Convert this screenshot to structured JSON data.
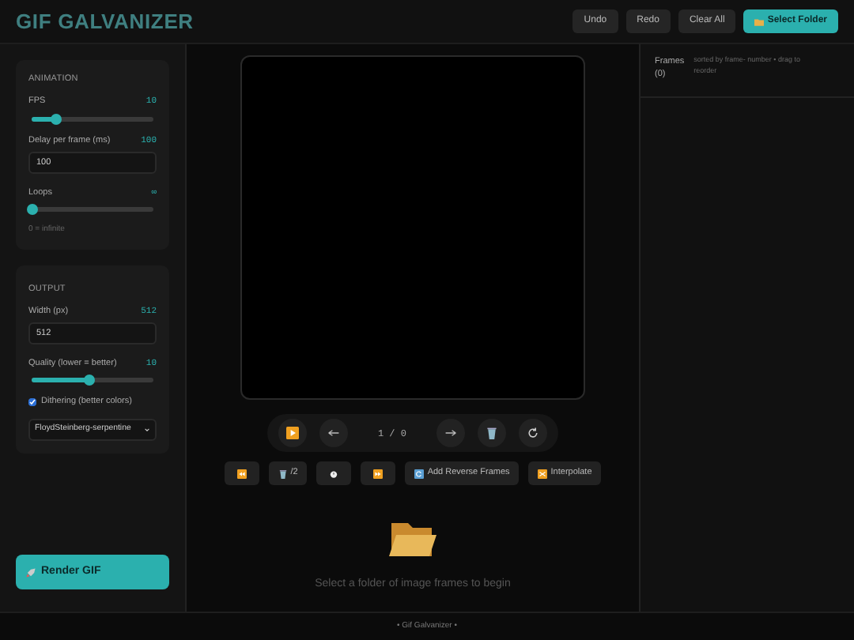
{
  "header": {
    "title": "GIF GALVANIZER",
    "buttons": [
      {
        "label": "Undo",
        "kind": "plain"
      },
      {
        "label": "Redo",
        "kind": "plain"
      },
      {
        "label": "Clear All",
        "kind": "plain"
      },
      {
        "label": "Select Folder",
        "kind": "primary"
      }
    ]
  },
  "animation": {
    "heading": "ANIMATION",
    "fps": {
      "label": "FPS",
      "reading": "10",
      "level": 0.2
    },
    "delay": {
      "label": "Delay per frame (ms)",
      "reading": "100",
      "value": "100"
    },
    "loops": {
      "label": "Loops",
      "reading": "∞",
      "level": 0
    },
    "hint": "0 = infinite"
  },
  "output": {
    "heading": "OUTPUT",
    "width": {
      "label": "Width (px)",
      "reading": "512",
      "value": "512"
    },
    "quality": {
      "label": "Quality (lower = better)",
      "reading": "10",
      "level": 0.48
    },
    "dithering": {
      "label": "Dithering (better colors)",
      "checked": true
    },
    "dither_mode": "FloydSteinberg-serpentine"
  },
  "render_button": "Render GIF",
  "player": {
    "counter": "1 / 0",
    "controls": [
      {
        "kind": "play"
      },
      {
        "kind": "prev"
      },
      {
        "kind": "counter"
      },
      {
        "kind": "next"
      },
      {
        "kind": "trash"
      },
      {
        "kind": "reset"
      }
    ]
  },
  "tools": [
    {
      "kind": "rewind"
    },
    {
      "kind": "halve",
      "label": "/2"
    },
    {
      "kind": "timer"
    },
    {
      "kind": "forward"
    },
    {
      "kind": "reverse",
      "label": "Add Reverse Frames"
    },
    {
      "kind": "shuffle",
      "label": "Interpolate"
    }
  ],
  "empty_message": "Select a folder of image frames to begin",
  "frames_panel": {
    "title": "Frames",
    "count": "(0)",
    "hint": "sorted by frame- number • drag to reorder"
  },
  "footer": "• Gif Galvanizer •"
}
